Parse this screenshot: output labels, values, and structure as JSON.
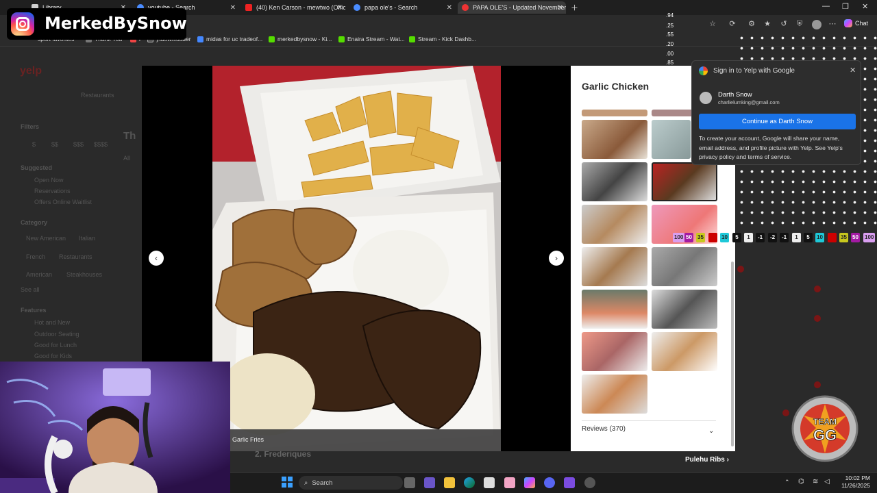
{
  "tabs": [
    {
      "title": "Library",
      "color": "#d0d0d0"
    },
    {
      "title": "youtube - Search",
      "color": "#4a8cff"
    },
    {
      "title": "(40) Ken Carson - mewtwo (Offici",
      "color": "#e22"
    },
    {
      "title": "papa ole's - Search",
      "color": "#4a8cff"
    },
    {
      "title": "PAPA OLE'S - Updated November",
      "color": "#e33",
      "active": true
    }
  ],
  "favorites": [
    "sport favorites",
    "Thank You",
    "i",
    "ytdownloader",
    "midas for uc tradeof...",
    "merkedbysnow - Ki...",
    "Enaira Stream - Wat...",
    "Stream - Kick Dashb..."
  ],
  "chat_label": "Chat",
  "overlay": {
    "channel": "MerkedBySnow",
    "team": "TEAM GG"
  },
  "rnums": [
    ".94",
    ".25",
    ".55",
    ".20",
    ".00",
    ".85"
  ],
  "yelp": {
    "logo": "yelp"
  },
  "background_page": {
    "filters": "Filters",
    "prices": [
      "$",
      "$$",
      "$$$",
      "$$$$"
    ],
    "suggested": "Suggested",
    "suggested_items": [
      "Open Now",
      "Reservations",
      "Offers Online Waitlist"
    ],
    "category": "Category",
    "categories": [
      "New American",
      "Italian",
      "French",
      "Restaurants",
      "American",
      "Steakhouses"
    ],
    "see_all": "See all",
    "features": "Features",
    "feature_items": [
      "Hot and New",
      "Outdoor Seating",
      "Good for Lunch",
      "Good for Kids"
    ],
    "restaurants": "Restaurants",
    "title_letters": "Th",
    "all": "All",
    "result": "2. Frederiques"
  },
  "modal": {
    "title": "Garlic Chicken",
    "caption": "Garlic Fries",
    "reviews": "Reviews (370)",
    "prev": "‹",
    "next": "›"
  },
  "google": {
    "title": "Sign in to Yelp with Google",
    "account_name": "Darth Snow",
    "account_email": "charlielumking@gmail.com",
    "button": "Continue as Darth Snow",
    "note": "To create your account, Google will share your name, email address, and profile picture with Yelp. See Yelp's privacy policy and terms of service."
  },
  "chips": [
    {
      "t": "100",
      "bg": "#d99ef0",
      "fg": "#222"
    },
    {
      "t": "50",
      "bg": "#a31aa3",
      "fg": "#fff"
    },
    {
      "t": "35",
      "bg": "#c8c81e",
      "fg": "#222"
    },
    {
      "t": "",
      "bg": "#c00",
      "fg": "#fff"
    },
    {
      "t": "10",
      "bg": "#1ec8d8",
      "fg": "#222"
    },
    {
      "t": "5",
      "bg": "#111",
      "fg": "#fff"
    },
    {
      "t": "1",
      "bg": "#eee",
      "fg": "#222"
    },
    {
      "t": "-1",
      "bg": "#111",
      "fg": "#fff"
    },
    {
      "t": "-2",
      "bg": "#111",
      "fg": "#fff"
    },
    {
      "t": "-1",
      "bg": "#111",
      "fg": "#fff"
    },
    {
      "t": "1",
      "bg": "#eee",
      "fg": "#222"
    },
    {
      "t": "5",
      "bg": "#111",
      "fg": "#fff"
    },
    {
      "t": "10",
      "bg": "#1ec8d8",
      "fg": "#222"
    },
    {
      "t": "",
      "bg": "#c00",
      "fg": "#fff"
    },
    {
      "t": "35",
      "bg": "#c8c81e",
      "fg": "#222"
    },
    {
      "t": "50",
      "bg": "#a31aa3",
      "fg": "#fff"
    },
    {
      "t": "100",
      "bg": "#d99ef0",
      "fg": "#222"
    }
  ],
  "pulehu": "Pulehu Ribs",
  "taskbar": {
    "search": "Search",
    "time": "10:02 PM",
    "date": "11/26/2025"
  }
}
